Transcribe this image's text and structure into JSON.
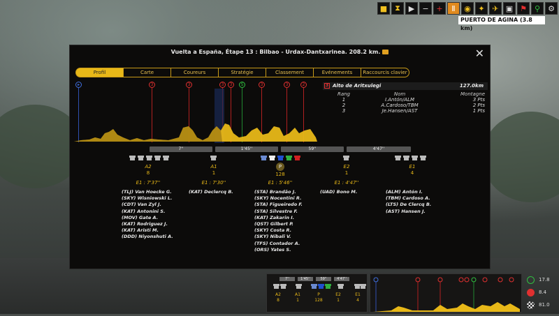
{
  "location_label": "PUERTO DE AGINA (3.8 km)",
  "modal": {
    "title": "Vuelta a España, Étape 13 : Bilbao - Urdax-Dantxarinea. 208.2 km."
  },
  "tabs": [
    "Profil",
    "Carte",
    "Coureurs",
    "Stratégie",
    "Classement",
    "Evénements",
    "Raccourcis clavier"
  ],
  "profile_markers": [
    "3",
    "3",
    "3",
    "3",
    "S",
    "3",
    "3",
    "2"
  ],
  "climb": {
    "category": "3",
    "name": "Alto de Aritxulegi",
    "distance": "127.0km",
    "headers": [
      "Rang",
      "Nom",
      "Montagne"
    ],
    "rows": [
      [
        "1",
        "I.Antón/ALM",
        "3 Pts"
      ],
      [
        "2",
        "A.Cardoso/TBM",
        "2 Pts"
      ],
      [
        "3",
        "Je.Hansen/AST",
        "1 Pts"
      ]
    ]
  },
  "gaps": [
    "7''",
    "1'45''",
    "59''",
    "4'47''"
  ],
  "groups": [
    {
      "label": "A2",
      "count": "8",
      "time": "E1 : 7'37''",
      "riders": [
        "(TLJ) Van Hoecke G.",
        "(SKY) Wisniowski L.",
        "(CDT) Van Zyl J.",
        "(KAT) Antonini S.",
        "(MOV) Gate A.",
        "(KAT) Rodriguez J.",
        "(KAT) Aristi M.",
        "(DDD) Niyonshuti A."
      ]
    },
    {
      "label": "A1",
      "count": "1",
      "time": "E1 : 7'30''",
      "riders": [
        "(KAT) Declercq B."
      ]
    },
    {
      "label": "P",
      "count": "128",
      "time": "E1 : 5'46''",
      "riders": [
        "(STA) Brandão J.",
        "(SKY) Nocentini R.",
        "(STA) Figueiredo F.",
        "(STA) Silvestre F.",
        "(KAT) Zakarin I.",
        "(QST) Gilbert P.",
        "(SKY) Costa R.",
        "(SKY) Nibali V.",
        "(TFS) Contador A.",
        "(ORS) Yates S."
      ]
    },
    {
      "label": "E2",
      "count": "1",
      "time": "E1 : 4'47''",
      "riders": [
        "(UAD) Bono M."
      ]
    },
    {
      "label": "E1",
      "count": "4",
      "time": "",
      "riders": [
        "(ALM) Antón I.",
        "(TBM) Cardoso A.",
        "(LTS) De Clercq B.",
        "(AST) Hansen J."
      ]
    }
  ],
  "mini": {
    "gaps": [
      "7''",
      "1'45''",
      "59''",
      "4'47''"
    ],
    "labels": [
      "A2",
      "A1",
      "P",
      "E2",
      "E1"
    ],
    "counts": [
      "8",
      "1",
      "128",
      "1",
      "4"
    ]
  },
  "stats": [
    "17.8",
    "8.4",
    "81.0"
  ],
  "colors": {
    "accent": "#e8b818",
    "climb": "#e03030",
    "sprint": "#30c040"
  }
}
